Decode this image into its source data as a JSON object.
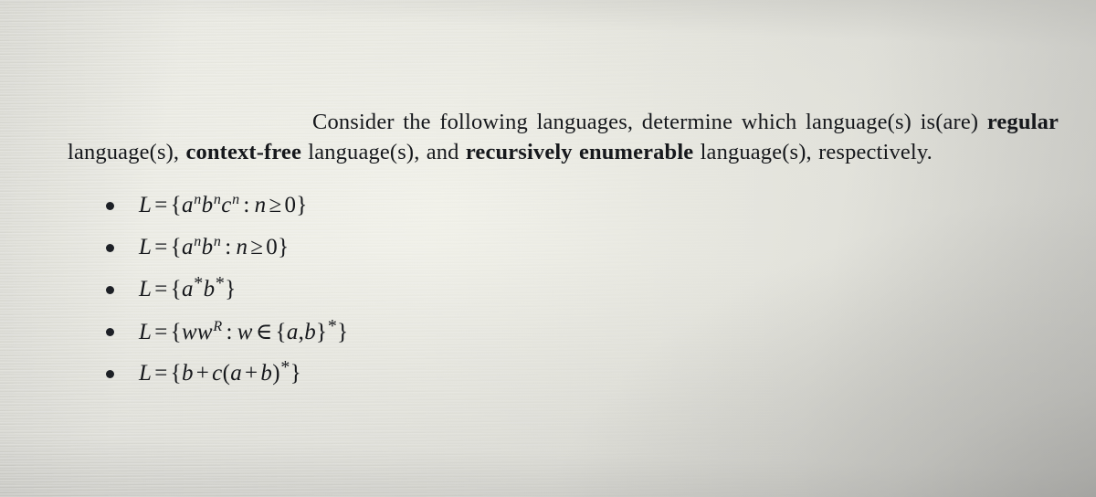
{
  "document": {
    "type": "photographed-textbook-question",
    "subject": "formal-languages",
    "background_color": "#e3e3dc",
    "text_color": "#16181c"
  },
  "prompt": {
    "lead_in": "Consider the following languages, determine which language(s) is(are) ",
    "term_regular": "regular",
    "after_regular": " language(s), ",
    "term_context_free": "context-free",
    "after_context_free": " language(s), and ",
    "term_recursively_enumerable": "recursively enumerable",
    "after_recursively_enumerable": " language(s), respectively.",
    "full_text": "Consider the following languages, determine which language(s) is(are) regular language(s), context-free language(s), and recursively enumerable language(s), respectively."
  },
  "languages": {
    "bullet_glyph": "•",
    "items": [
      {
        "id": "lang-anbncn",
        "plain": "L = {a^n b^n c^n : n >= 0}",
        "lhs": "L",
        "equals": "=",
        "open_brace": "{",
        "base_1": "a",
        "exp_1": "n",
        "base_2": "b",
        "exp_2": "n",
        "base_3": "c",
        "exp_3": "n",
        "colon": ":",
        "var": "n",
        "relation": "≥",
        "bound": "0",
        "close_brace": "}"
      },
      {
        "id": "lang-anbn",
        "plain": "L = {a^n b^n : n >= 0}",
        "lhs": "L",
        "equals": "=",
        "open_brace": "{",
        "base_1": "a",
        "exp_1": "n",
        "base_2": "b",
        "exp_2": "n",
        "colon": ":",
        "var": "n",
        "relation": "≥",
        "bound": "0",
        "close_brace": "}"
      },
      {
        "id": "lang-astar-bstar",
        "plain": "L = {a* b*}",
        "lhs": "L",
        "equals": "=",
        "open_brace": "{",
        "base_1": "a",
        "exp_1": "*",
        "base_2": "b",
        "exp_2": "*",
        "close_brace": "}"
      },
      {
        "id": "lang-ww-reverse",
        "plain": "L = {ww^R : w ∈ {a,b}*}",
        "lhs": "L",
        "equals": "=",
        "open_brace": "{",
        "word_1": "w",
        "word_2": "w",
        "exp_reverse": "R",
        "colon": ":",
        "var": "w",
        "member": "∈",
        "set_open": "{",
        "set_a": "a",
        "set_comma": ",",
        "set_b": "b",
        "set_close": "}",
        "set_star": "*",
        "close_brace": "}"
      },
      {
        "id": "lang-regex-b-plus-c",
        "plain": "L = {b + c(a + b)*}",
        "lhs": "L",
        "equals": "=",
        "open_brace": "{",
        "term_1": "b",
        "plus_1": "+",
        "term_2": "c",
        "paren_open": "(",
        "term_3": "a",
        "plus_2": "+",
        "term_4": "b",
        "paren_close": ")",
        "star": "*",
        "close_brace": "}"
      }
    ]
  }
}
